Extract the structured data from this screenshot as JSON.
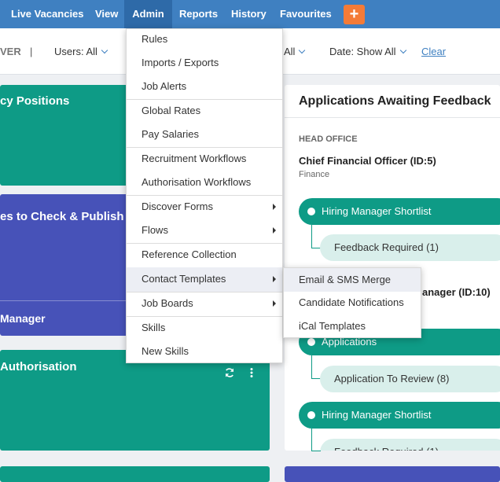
{
  "nav": {
    "items": [
      "Live Vacancies",
      "View",
      "Admin",
      "Reports",
      "History",
      "Favourites"
    ],
    "plus_label": "+"
  },
  "filters": {
    "ver_label": "VER",
    "divider": "|",
    "users": "Users: All",
    "all_partial": "All",
    "date": "Date: Show All",
    "clear": "Clear"
  },
  "cards": {
    "vacancy_positions": "cy Positions",
    "check_publish": "es to Check & Publish",
    "manager": "Manager",
    "authorisation": "Authorisation"
  },
  "panel": {
    "title": "Applications Awaiting Feedback",
    "office": "HEAD OFFICE",
    "job1_title": "Chief Financial Officer (ID:5)",
    "job1_dept": "Finance",
    "stage1": "Hiring Manager Shortlist",
    "sub1": "Feedback Required (1)",
    "job2_partial": "anager (ID:10)",
    "stage2": "Applications",
    "sub2": "Application To Review (8)",
    "stage3": "Hiring Manager Shortlist",
    "sub3_partial": "Feedback Required (1)"
  },
  "admin_menu": {
    "items": [
      {
        "label": "Rules",
        "submenu": false
      },
      {
        "label": "Imports / Exports",
        "submenu": false
      },
      {
        "label": "Job Alerts",
        "submenu": false
      },
      {
        "label": "Global Rates",
        "submenu": false
      },
      {
        "label": "Pay Salaries",
        "submenu": false
      },
      {
        "label": "Recruitment Workflows",
        "submenu": false
      },
      {
        "label": "Authorisation Workflows",
        "submenu": false
      },
      {
        "label": "Discover Forms",
        "submenu": true
      },
      {
        "label": "Flows",
        "submenu": true
      },
      {
        "label": "Reference Collection",
        "submenu": false
      },
      {
        "label": "Contact Templates",
        "submenu": true
      },
      {
        "label": "Job Boards",
        "submenu": true
      },
      {
        "label": "Skills",
        "submenu": false
      },
      {
        "label": "New Skills",
        "submenu": false
      }
    ]
  },
  "contact_submenu": {
    "items": [
      "Email & SMS Merge",
      "Candidate Notifications",
      "iCal Templates"
    ]
  },
  "colors": {
    "nav_bg": "#3f80c1",
    "teal": "#0e9b86",
    "indigo": "#4752b8",
    "orange": "#f47b37"
  },
  "icons": [
    "refresh-icon",
    "more-vertical-icon",
    "chevron-down-icon",
    "chevron-right-icon"
  ]
}
